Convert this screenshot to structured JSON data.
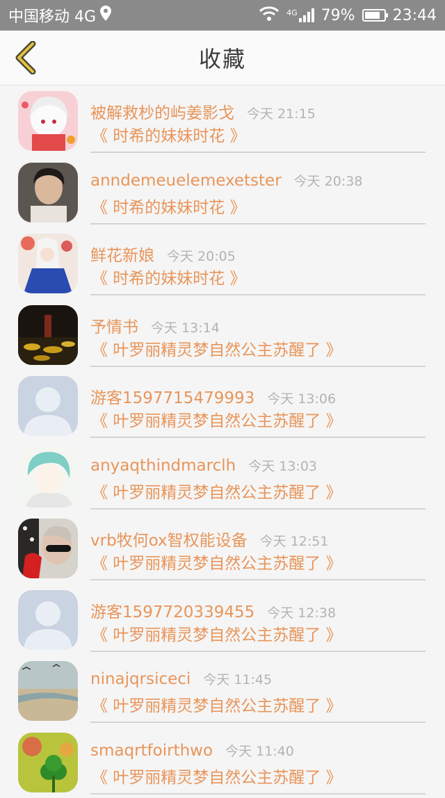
{
  "status_bar": {
    "carrier": "中国移动 4G",
    "network": "4G",
    "battery": "79%",
    "battery_level": 0.79,
    "time": "23:44",
    "icons": [
      "location-icon",
      "wifi-icon",
      "signal-icon",
      "battery-icon"
    ]
  },
  "header": {
    "title": "收藏",
    "back_icon": "chevron-left-icon",
    "accent": "#e6c23a"
  },
  "colors": {
    "accent": "#e8955a",
    "time_text": "#b3b3b3",
    "divider": "#d4d4d4"
  },
  "favorites": [
    {
      "name": "被解救杪的屿姜影戈",
      "time": "今天 21:15",
      "title": "《 时希的妹妹时花 》",
      "avatar": "anime-girl-avatar"
    },
    {
      "name": "anndemeuelemexetster",
      "time": "今天 20:38",
      "title": "《 时希的妹妹时花 》",
      "avatar": "boy-photo-avatar"
    },
    {
      "name": "鲜花新娘",
      "time": "今天 20:05",
      "title": "《 时希的妹妹时花 》",
      "avatar": "anime-blue-dress-avatar"
    },
    {
      "name": "予情书",
      "time": "今天 13:14",
      "title": "《 叶罗丽精灵梦自然公主苏醒了 》",
      "avatar": "dark-scene-avatar"
    },
    {
      "name": "游客1597715479993",
      "time": "今天 13:06",
      "title": "《 叶罗丽精灵梦自然公主苏醒了 》",
      "avatar": "default-user-avatar"
    },
    {
      "name": "anyaqthindmarclh",
      "time": "今天 13:03",
      "title": "《 叶罗丽精灵梦自然公主苏醒了 》",
      "avatar": "anime-teal-hair-avatar"
    },
    {
      "name": "vrb牧何ox智权能设备",
      "time": "今天 12:51",
      "title": "《 叶罗丽精灵梦自然公主苏醒了 》",
      "avatar": "sunglasses-avatar"
    },
    {
      "name": "游客1597720339455",
      "time": "今天 12:38",
      "title": "《 叶罗丽精灵梦自然公主苏醒了 》",
      "avatar": "default-user-avatar"
    },
    {
      "name": "ninajqrsiceci",
      "time": "今天 11:45",
      "title": "《 叶罗丽精灵梦自然公主苏醒了 》",
      "avatar": "beach-landscape-avatar"
    },
    {
      "name": "smaqrtfoirthwo",
      "time": "今天 11:40",
      "title": "《 叶罗丽精灵梦自然公主苏醒了 》",
      "avatar": "clover-avatar"
    }
  ]
}
